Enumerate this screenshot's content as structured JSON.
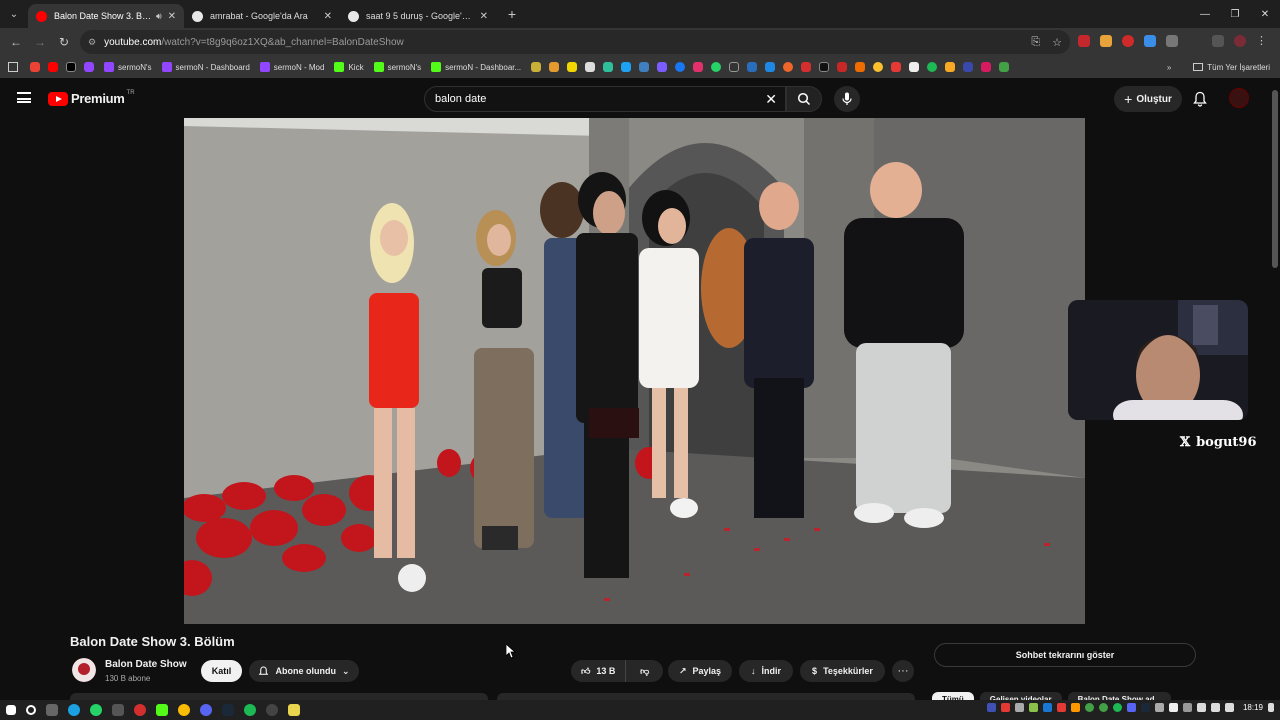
{
  "browser": {
    "tabs": [
      {
        "title": "Balon Date Show 3. Bölüm",
        "active": true,
        "favicon_color": "#ff0000",
        "audio": true
      },
      {
        "title": "amrabat - Google'da Ara",
        "active": false,
        "favicon_color": "#e8e8e8"
      },
      {
        "title": "saat 9 5 duruş - Google'da Ara",
        "active": false,
        "favicon_color": "#e8e8e8"
      }
    ],
    "new_tab": "+",
    "window_controls": {
      "minimize": "—",
      "maximize": "❐",
      "close": "✕"
    },
    "address": {
      "host": "youtube.com",
      "path": "/watch?v=t8g9q6oz1XQ&ab_channel=BalonDateShow"
    },
    "bookmarks": [
      {
        "label": "sermoN's",
        "color": "#9146ff"
      },
      {
        "label": "sermoN - Dashboard",
        "color": "#9146ff"
      },
      {
        "label": "sermoN - Mod",
        "color": "#9146ff"
      },
      {
        "label": "Kick",
        "color": "#53fc18"
      },
      {
        "label": "sermoN's",
        "color": "#53fc18"
      },
      {
        "label": "sermoN - Dashboar...",
        "color": "#53fc18"
      }
    ],
    "bookmarks_all": "Tüm Yer İşaretleri"
  },
  "youtube": {
    "brand": "Premium",
    "region": "TR",
    "search": {
      "value": "balon date"
    },
    "create_label": "Oluştur",
    "handle": "bogut96",
    "video": {
      "title": "Balon Date Show 3. Bölüm",
      "channel": "Balon Date Show",
      "subscribers": "130 B abone",
      "join_label": "Katıl",
      "subscribed_label": "Abone olundu",
      "likes": "13 B",
      "share_label": "Paylaş",
      "download_label": "İndir",
      "thanks_label": "Teşekkürler",
      "more_label": "···"
    },
    "chat_replay_label": "Sohbet tekrarını göster",
    "chips": [
      "Tümü",
      "Gelişen videolar",
      "Balon Date Show ad..."
    ]
  },
  "taskbar": {
    "time": "18:19"
  }
}
